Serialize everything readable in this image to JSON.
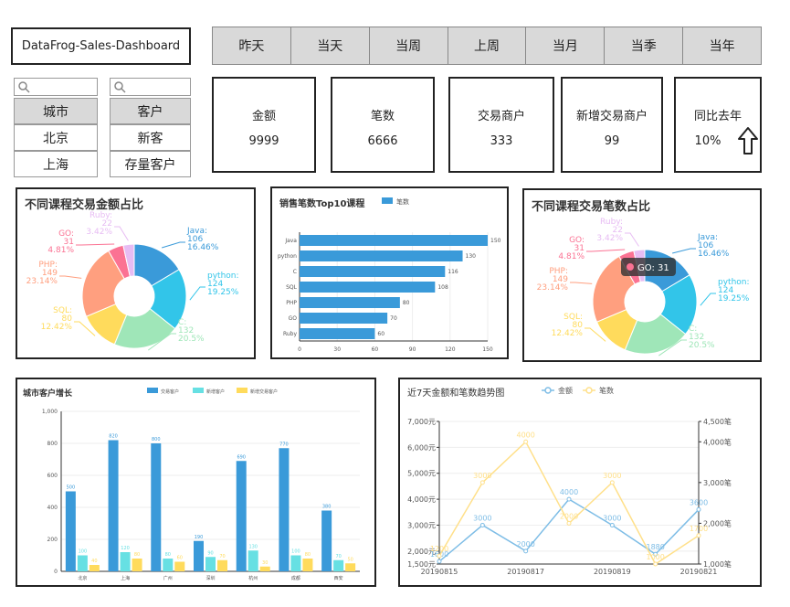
{
  "app": {
    "title": "DataFrog-Sales-Dashboard"
  },
  "time_tabs": [
    "昨天",
    "当天",
    "当周",
    "上周",
    "当月",
    "当季",
    "当年"
  ],
  "filters": {
    "city": {
      "header": "城市",
      "options": [
        "北京",
        "上海"
      ]
    },
    "customer": {
      "header": "客户",
      "options": [
        "新客",
        "存量客户"
      ]
    }
  },
  "kpis": [
    {
      "label": "金额",
      "value": "9999"
    },
    {
      "label": "笔数",
      "value": "6666"
    },
    {
      "label": "交易商户",
      "value": "333"
    },
    {
      "label": "新增交易商户",
      "value": "99"
    },
    {
      "label": "同比去年",
      "value": "10%"
    }
  ],
  "colors": {
    "java": "#3a9ad9",
    "python": "#32c5e9",
    "c": "#9fe6b8",
    "sql": "#ffdb5c",
    "php": "#ff9f7f",
    "go": "#fb7293",
    "ruby": "#e7bcf3",
    "bar": "#3a9ad9",
    "cyan": "#67e0e3",
    "yellow": "#ffdb5c",
    "line_blue": "#7ebde6",
    "line_yellow": "#ffe08a"
  },
  "chart_data": [
    {
      "type": "pie",
      "title": "不同课程交易金额占比",
      "slices": [
        {
          "name": "Java",
          "value": 106,
          "percent": "16.46%"
        },
        {
          "name": "python",
          "value": 124,
          "percent": "19.25%"
        },
        {
          "name": "C",
          "value": 132,
          "percent": "20.5%"
        },
        {
          "name": "SQL",
          "value": 80,
          "percent": "12.42%"
        },
        {
          "name": "PHP",
          "value": 149,
          "percent": "23.14%"
        },
        {
          "name": "GO",
          "value": 31,
          "percent": "4.81%"
        },
        {
          "name": "Ruby",
          "value": 22,
          "percent": "3.42%"
        }
      ]
    },
    {
      "type": "bar",
      "orientation": "horizontal",
      "title": "销售笔数Top10课程",
      "legend": [
        "笔数"
      ],
      "categories": [
        "Java",
        "python",
        "C",
        "SQL",
        "PHP",
        "GO",
        "Ruby"
      ],
      "values": [
        150,
        130,
        116,
        108,
        80,
        70,
        60
      ],
      "xlim": [
        0,
        150
      ],
      "xticks": [
        0,
        30,
        60,
        90,
        120,
        150
      ]
    },
    {
      "type": "pie",
      "title": "不同课程交易笔数占比",
      "tooltip": "GO: 31",
      "slices": [
        {
          "name": "Java",
          "value": 106,
          "percent": "16.46%"
        },
        {
          "name": "python",
          "value": 124,
          "percent": "19.25%"
        },
        {
          "name": "C",
          "value": 132,
          "percent": "20.5%"
        },
        {
          "name": "SQL",
          "value": 80,
          "percent": "12.42%"
        },
        {
          "name": "PHP",
          "value": 149,
          "percent": "23.14%"
        },
        {
          "name": "GO",
          "value": 31,
          "percent": "4.81%"
        },
        {
          "name": "Ruby",
          "value": 22,
          "percent": "3.42%"
        }
      ]
    },
    {
      "type": "bar",
      "title": "城市客户增长",
      "categories": [
        "北京",
        "上海",
        "广州",
        "深圳",
        "杭州",
        "成都",
        "西安"
      ],
      "series": [
        {
          "name": "交易客户",
          "values": [
            500,
            820,
            800,
            190,
            690,
            770,
            380
          ]
        },
        {
          "name": "新增客户",
          "values": [
            100,
            120,
            80,
            90,
            130,
            100,
            70
          ]
        },
        {
          "name": "新增交易客户",
          "values": [
            40,
            80,
            60,
            70,
            30,
            80,
            50
          ]
        }
      ],
      "ylim": [
        0,
        1000
      ],
      "yticks": [
        "0",
        "200",
        "400",
        "600",
        "800",
        "1,000"
      ]
    },
    {
      "type": "line",
      "title": "近7天金额和笔数趋势图",
      "x": [
        "20190815",
        "20190816",
        "20190817",
        "20190818",
        "20190819",
        "20190820",
        "20190821"
      ],
      "xticks": [
        "20190815",
        "20190817",
        "20190819",
        "20190821"
      ],
      "series": [
        {
          "name": "金额",
          "axis": "left",
          "values": [
            1600,
            3000,
            2000,
            4000,
            3000,
            1880,
            3600
          ]
        },
        {
          "name": "笔数",
          "axis": "right",
          "values": [
            1200,
            3000,
            4000,
            2000,
            3000,
            1000,
            1700
          ]
        }
      ],
      "ylim_left": [
        1500,
        7000
      ],
      "yticks_left": [
        "1,500元",
        "2,000元",
        "3,000元",
        "4,000元",
        "5,000元",
        "6,000元",
        "7,000元"
      ],
      "ylim_right": [
        1000,
        4500
      ],
      "yticks_right": [
        "1,000笔",
        "2,000笔",
        "3,000笔",
        "4,000笔",
        "4,500笔"
      ]
    }
  ]
}
